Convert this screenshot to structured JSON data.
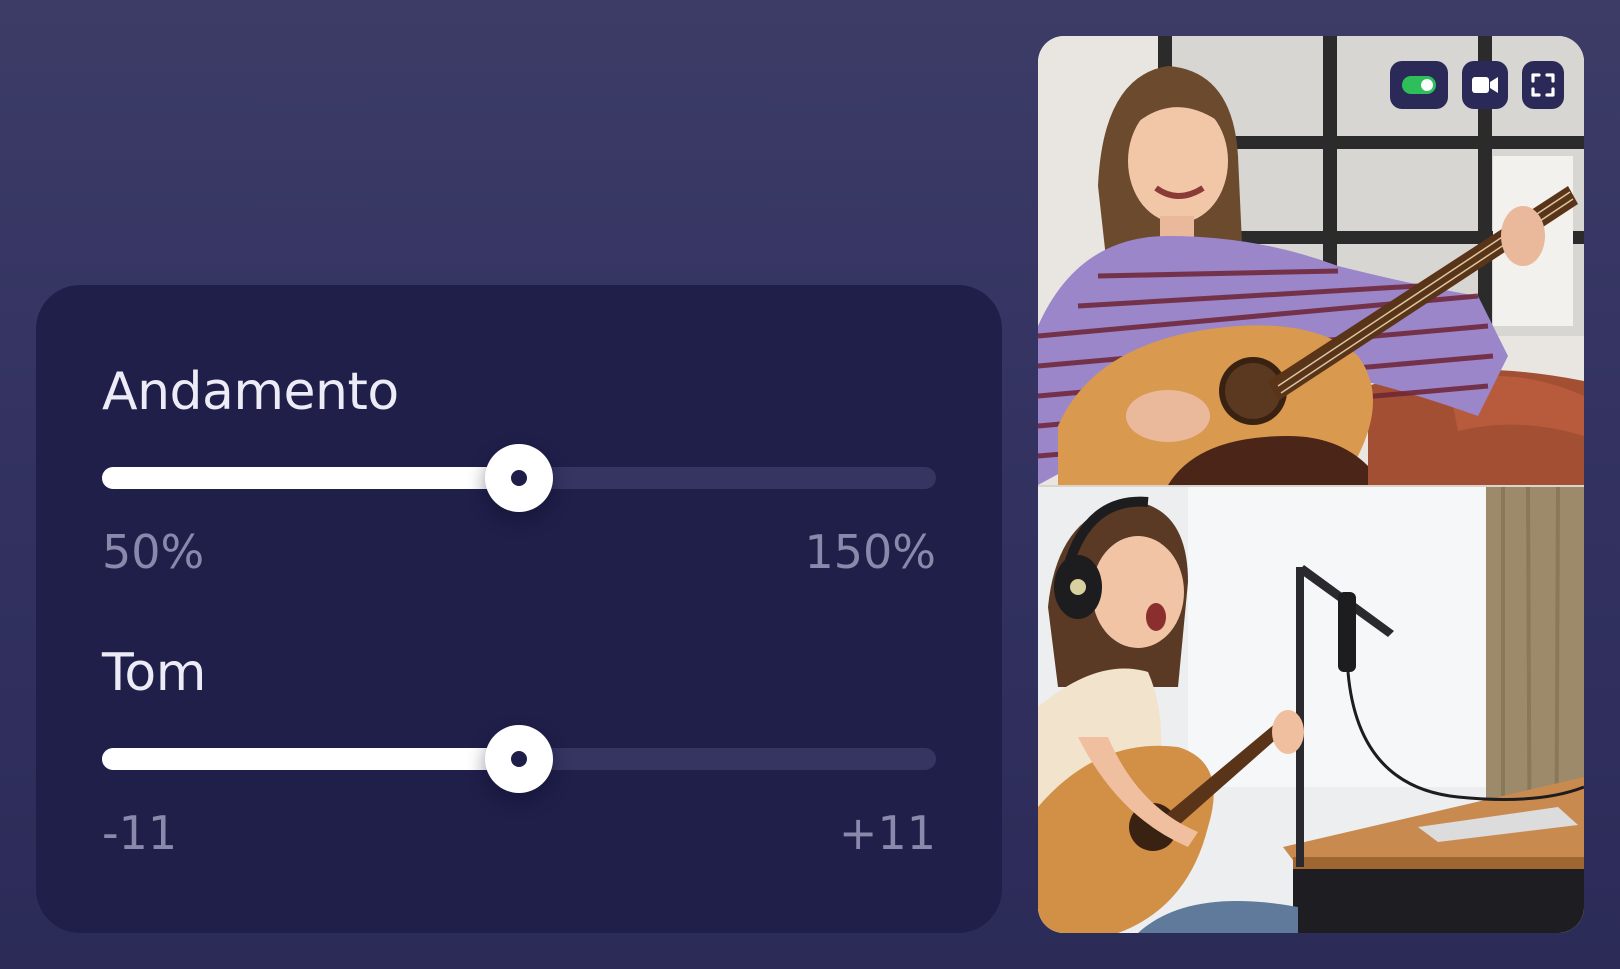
{
  "tempo": {
    "title": "Andamento",
    "min_label": "50%",
    "max_label": "150%",
    "value_fraction": 0.5
  },
  "pitch": {
    "title": "Tom",
    "min_label": "-11",
    "max_label": "+11",
    "value_fraction": 0.5
  },
  "video_controls": {
    "toggle_on": true,
    "toggle_color": "#2fbf5a",
    "icons": [
      "toggle-switch",
      "video-camera-icon",
      "fullscreen-icon"
    ]
  },
  "colors": {
    "background": "#343363",
    "panel": "#201f4a",
    "track": "#363562",
    "fill": "#ffffff",
    "muted_text": "#8a89ab"
  }
}
